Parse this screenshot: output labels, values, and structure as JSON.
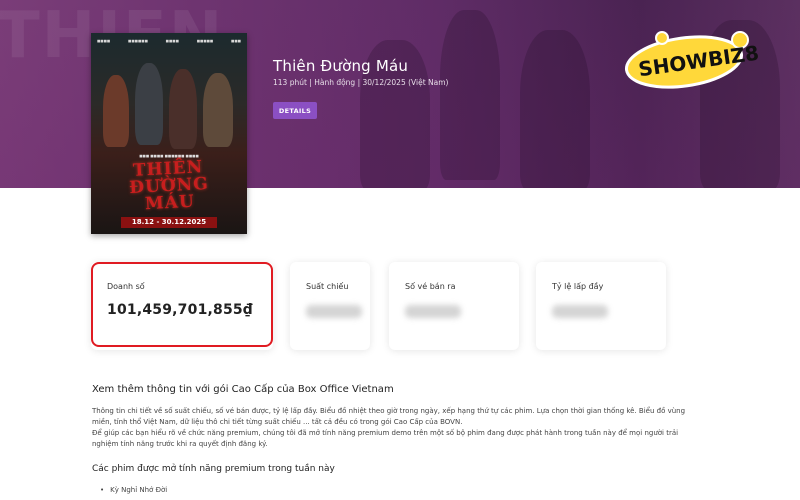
{
  "hero": {
    "background_text": "THIEN",
    "movie": {
      "title": "Thiên Đường Máu",
      "meta": "113 phút  | Hành động  | 30/12/2025 (Việt Nam)",
      "details_button": "DETAILS"
    },
    "logo_text": "SHOWBIZ8"
  },
  "poster": {
    "title_line1": "THIÊN",
    "title_line2": "ĐƯỜNG",
    "title_line3": "MÁU",
    "date": "18.12 - 30.12.2025"
  },
  "stats": [
    {
      "label": "Doanh số",
      "value": "101,459,701,855₫",
      "highlighted": true
    },
    {
      "label": "Suất chiếu",
      "value": ""
    },
    {
      "label": "Số vé bán ra",
      "value": ""
    },
    {
      "label": "Tỷ lệ lấp đầy",
      "value": ""
    }
  ],
  "premium": {
    "title": "Xem thêm thông tin với gói Cao Cấp của Box Office Vietnam",
    "paragraph1": "Thông tin chi tiết về số suất chiếu, số vé bán được, tỷ lệ lấp đầy. Biểu đồ nhiệt theo giờ trong ngày, xếp hạng thứ tự các phim. Lựa chọn thời gian thống kê. Biểu đồ vùng miền, tỉnh thổ Việt Nam, dữ liệu thô chi tiết từng suất chiếu ... tất cả đều có trong gói Cao Cấp của BOVN.",
    "paragraph2": "Để giúp các bạn hiểu rõ về chức năng premium, chúng tôi đã mở tính năng premium demo trên một số bộ phim đang được phát hành trong tuần này để mọi người trải nghiệm tính năng trước khi ra quyết định đăng ký.",
    "subtitle": "Các phim được mở tính năng premium trong tuần này",
    "films": [
      "Kỳ Nghỉ Nhớ Đời"
    ]
  },
  "colors": {
    "hero": "#6e3470",
    "accent": "#8b4fc3",
    "highlight": "#e01b22",
    "poster_title": "#c81e1e"
  }
}
